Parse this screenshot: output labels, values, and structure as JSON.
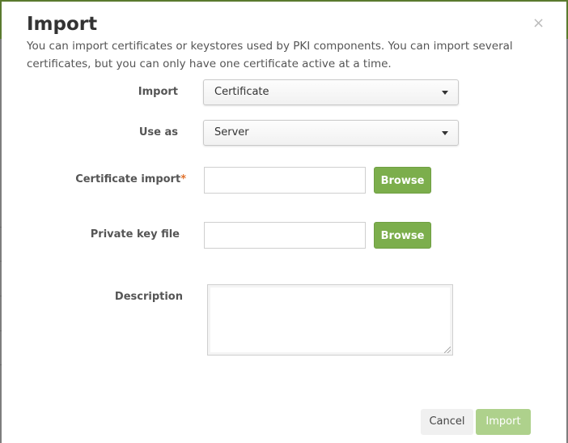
{
  "dialog": {
    "title": "Import",
    "close_icon": "×",
    "intro": "You can import certificates or keystores used by PKI components. You can import several certificates, but you can only have one certificate active at a time."
  },
  "form": {
    "import_label": "Import",
    "import_value": "Certificate",
    "use_as_label": "Use as",
    "use_as_value": "Server",
    "cert_label": "Certificate import",
    "required_mark": "*",
    "browse_label": "Browse",
    "key_label": "Private key file",
    "description_label": "Description"
  },
  "footer": {
    "cancel_label": "Cancel",
    "import_label": "Import"
  },
  "colors": {
    "accent_green": "#7cae4c",
    "disabled_green": "#aed18c",
    "required": "#e0712c"
  }
}
